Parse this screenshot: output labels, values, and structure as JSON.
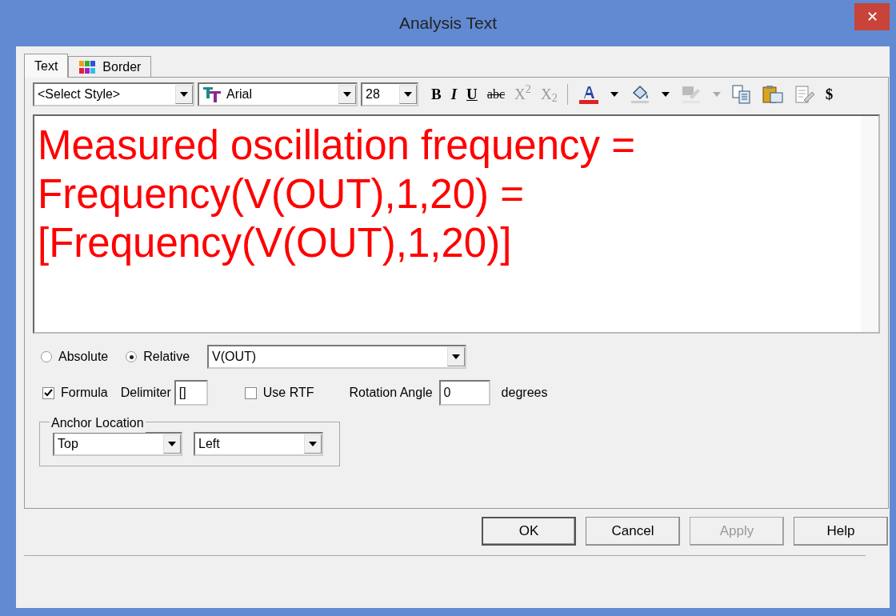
{
  "window": {
    "title": "Analysis Text",
    "close": "✕"
  },
  "tabs": [
    {
      "label": "Text",
      "selected": true,
      "icon": false
    },
    {
      "label": "Border",
      "selected": false,
      "icon": true
    }
  ],
  "toolbar": {
    "style_select": "<Select Style>",
    "font_select": "Arial",
    "size_select": "28",
    "buttons": [
      {
        "kind": "glyph",
        "label": "B",
        "disabled": false
      },
      {
        "kind": "glyph",
        "label": "I",
        "disabled": false
      },
      {
        "kind": "glyph",
        "label": "U",
        "disabled": false
      },
      {
        "kind": "glyph",
        "label": "abc",
        "disabled": false
      },
      {
        "kind": "glyph",
        "label": "X$^{2}$",
        "disabled": true
      },
      {
        "kind": "glyph",
        "label": "X$_{2}$",
        "disabled": true
      },
      {
        "kind": "separator"
      },
      {
        "kind": "fontcolor",
        "disabled": false
      },
      {
        "kind": "dropdown",
        "disabled": false
      },
      {
        "kind": "fill",
        "disabled": false
      },
      {
        "kind": "dropdown",
        "disabled": false
      },
      {
        "kind": "highlight",
        "disabled": true
      },
      {
        "kind": "dropdown",
        "disabled": true
      },
      {
        "kind": "copy",
        "disabled": false
      },
      {
        "kind": "paste",
        "disabled": false
      },
      {
        "kind": "edit",
        "disabled": false
      },
      {
        "kind": "glyph",
        "label": "$",
        "disabled": false
      }
    ]
  },
  "editor": {
    "lines": [
      "Measured oscillation frequency =",
      "Frequency(V(OUT),1,20) =",
      "[Frequency(V(OUT),1,20)]"
    ],
    "color": "#ff0000"
  },
  "position": [
    {
      "label": "Absolute",
      "selected": false
    },
    {
      "label": "Relative",
      "selected": true
    }
  ],
  "relative_to": "V(OUT)",
  "formula": {
    "label": "Formula",
    "checked": true
  },
  "delimiter": {
    "label": "Delimiter",
    "value": "[]"
  },
  "use_rtf": {
    "label": "Use RTF",
    "checked": false
  },
  "rotation": {
    "label": "Rotation Angle",
    "value": "0",
    "unit": "degrees"
  },
  "anchor": {
    "title": "Anchor Location",
    "vertical": "Top",
    "horizontal": "Left"
  },
  "buttons": [
    {
      "label": "OK",
      "disabled": false,
      "default": true
    },
    {
      "label": "Cancel",
      "disabled": false,
      "default": false
    },
    {
      "label": "Apply",
      "disabled": true,
      "default": false
    },
    {
      "label": "Help",
      "disabled": false,
      "default": false
    }
  ]
}
